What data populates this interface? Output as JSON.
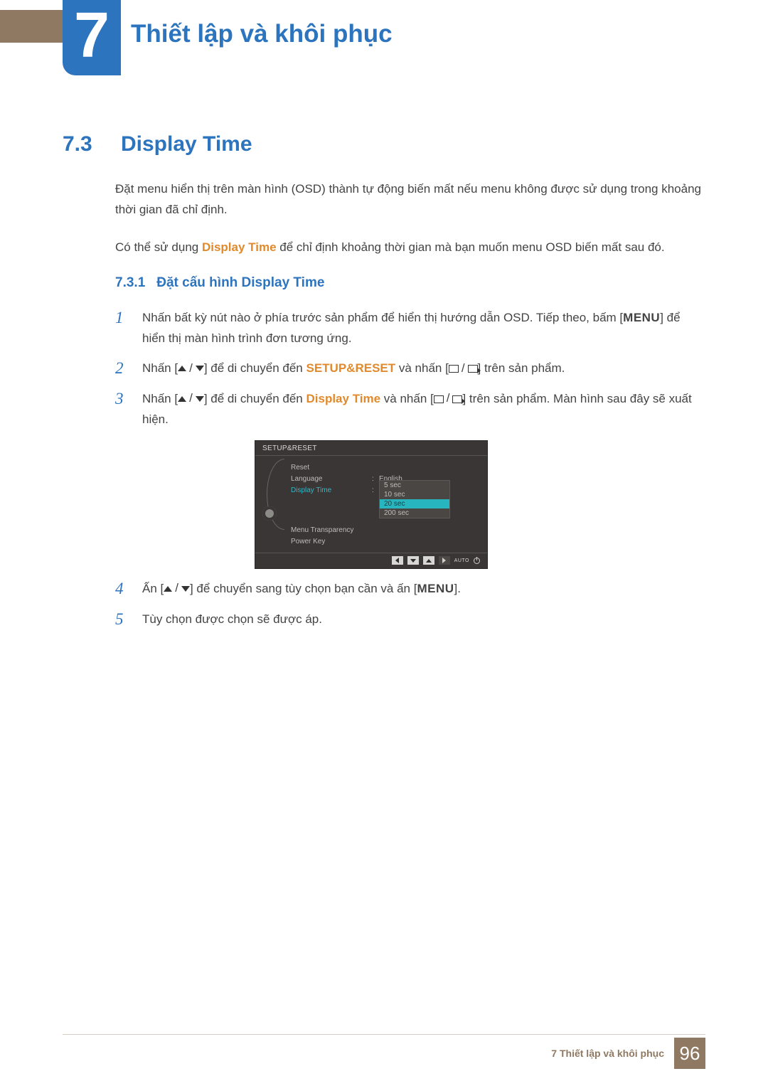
{
  "chapter": {
    "number": "7",
    "title": "Thiết lập và khôi phục"
  },
  "section": {
    "number": "7.3",
    "title": "Display Time"
  },
  "intro": {
    "p1": "Đặt menu hiển thị trên màn hình (OSD) thành tự động biến mất nếu menu không được sử dụng trong khoảng thời gian đã chỉ định.",
    "p2a": "Có thể sử dụng ",
    "p2_hl": "Display Time",
    "p2b": " để chỉ định khoảng thời gian mà bạn muốn menu OSD biến mất sau đó."
  },
  "subsection": {
    "number": "7.3.1",
    "title": "Đặt cấu hình Display Time"
  },
  "steps": {
    "s1": {
      "num": "1",
      "a": "Nhấn bất kỳ nút nào ở phía trước sản phẩm để hiển thị hướng dẫn OSD. Tiếp theo, bấm [",
      "menu": "MENU",
      "b": "] để hiển thị màn hình trình đơn tương ứng."
    },
    "s2": {
      "num": "2",
      "a": "Nhấn [",
      "b": "] để di chuyển đến ",
      "hl": "SETUP&RESET",
      "c": " và nhấn [",
      "d": "] trên sản phẩm."
    },
    "s3": {
      "num": "3",
      "a": "Nhấn [",
      "b": "] để di chuyển đến ",
      "hl": "Display Time",
      "c": " và nhấn [",
      "d": "] trên sản phẩm. Màn hình sau đây sẽ xuất hiện."
    },
    "s4": {
      "num": "4",
      "a": "Ấn [",
      "b": "] để chuyển sang tùy chọn bạn cần và ấn [",
      "menu": "MENU",
      "c": "]."
    },
    "s5": {
      "num": "5",
      "text": "Tùy chọn được chọn sẽ được áp."
    }
  },
  "osd": {
    "header": "SETUP&RESET",
    "rows": {
      "reset": "Reset",
      "language": {
        "label": "Language",
        "value": "English"
      },
      "display_time": "Display Time",
      "menu_transparency": "Menu Transparency",
      "power_key": "Power Key"
    },
    "options": [
      "5 sec",
      "10 sec",
      "20 sec",
      "200 sec"
    ],
    "selected_option_index": 2,
    "footer_auto": "AUTO"
  },
  "footer": {
    "chapter_label": "7 Thiết lập và khôi phục",
    "page": "96"
  }
}
